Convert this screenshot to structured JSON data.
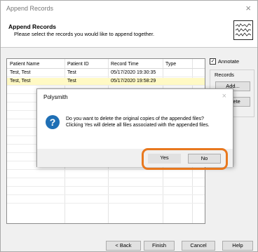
{
  "window": {
    "title": "Append Records",
    "close_glyph": "×"
  },
  "header": {
    "title": "Append Records",
    "subtitle": "Please select the records you would like to append together.",
    "icon": "waveform-icon"
  },
  "grid": {
    "columns": [
      "Patient Name",
      "Patient ID",
      "Record Time",
      "Type"
    ],
    "rows": [
      {
        "name": "Test, Test",
        "id": "Test",
        "time": "05/17/2020 19:30:35",
        "type": "",
        "selected": false
      },
      {
        "name": "Test, Test",
        "id": "Test",
        "time": "05/17/2020 19:58:29",
        "type": "",
        "selected": true
      }
    ]
  },
  "side": {
    "annotate_label": "Annotate",
    "annotate_checked": true,
    "annotate_check_glyph": "✓",
    "records_label": "Records",
    "add_label": "Add...",
    "delete_label": "Delete"
  },
  "footer": {
    "back_label": "< Back",
    "finish_label": "Finish",
    "cancel_label": "Cancel",
    "help_label": "Help"
  },
  "dialog": {
    "title": "Polysmith",
    "close_glyph": "×",
    "icon_glyph": "?",
    "message_line1": "Do you want to delete the original copies of the appended files?",
    "message_line2": "Clicking Yes will delete all files associated with the appended files.",
    "yes_label": "Yes",
    "no_label": "No"
  },
  "colors": {
    "highlight": "#e8781e",
    "selected_row": "#fff9c4",
    "question_icon": "#1f6fb5"
  }
}
